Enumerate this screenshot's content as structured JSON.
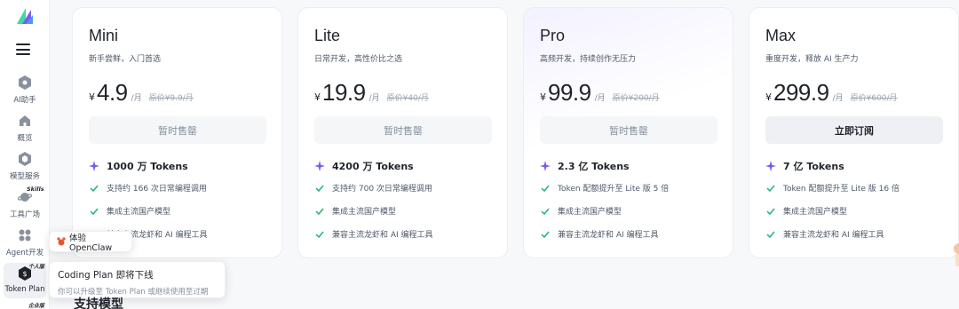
{
  "sidebar": {
    "items": [
      {
        "label": "AI助手",
        "icon": "hexagon-icon"
      },
      {
        "label": "概览",
        "icon": "home-icon"
      },
      {
        "label": "模型服务",
        "icon": "hexagon-icon"
      },
      {
        "label": "工具广场",
        "icon": "planet-icon",
        "tag": "Skills"
      },
      {
        "label": "Agent开发",
        "icon": "grid-icon"
      },
      {
        "label": "Token Plan",
        "icon": "token-icon",
        "tag": "个人版"
      }
    ],
    "bottom_tag": "企业版"
  },
  "plans": [
    {
      "name": "Mini",
      "subtitle": "新手尝鲜，入门首选",
      "currency": "¥",
      "price": "4.9",
      "unit": "/月",
      "original": "原价¥9.9/月",
      "cta": "暂时售罄",
      "cta_enabled": false,
      "tokens": "1000 万 Tokens",
      "features": [
        "支持约 166 次日常编程调用",
        "集成主流国产模型",
        "兼容主流龙虾和 AI 编程工具"
      ]
    },
    {
      "name": "Lite",
      "subtitle": "日常开发，高性价比之选",
      "currency": "¥",
      "price": "19.9",
      "unit": "/月",
      "original": "原价¥40/月",
      "cta": "暂时售罄",
      "cta_enabled": false,
      "tokens": "4200 万 Tokens",
      "features": [
        "支持约 700 次日常编程调用",
        "集成主流国产模型",
        "兼容主流龙虾和 AI 编程工具"
      ]
    },
    {
      "name": "Pro",
      "subtitle": "高频开发，持续创作无压力",
      "currency": "¥",
      "price": "99.9",
      "unit": "/月",
      "original": "原价¥200/月",
      "cta": "暂时售罄",
      "cta_enabled": false,
      "tokens": "2.3 亿 Tokens",
      "features": [
        "Token 配额提升至 Lite 版 5 倍",
        "集成主流国产模型",
        "兼容主流龙虾和 AI 编程工具"
      ]
    },
    {
      "name": "Max",
      "subtitle": "重度开发，释放 AI 生产力",
      "currency": "¥",
      "price": "299.9",
      "unit": "/月",
      "original": "原价¥600/月",
      "cta": "立即订阅",
      "cta_enabled": true,
      "tokens": "7 亿 Tokens",
      "features": [
        "Token 配额提升至 Lite 版 16 倍",
        "集成主流国产模型",
        "兼容主流龙虾和 AI 编程工具"
      ]
    }
  ],
  "popups": {
    "openclaw": "体验 OpenClaw",
    "notice_title": "Coding Plan 即将下线",
    "notice_body": "你可以升级至 Token Plan 或继续使用至过期"
  },
  "section_title": "支持模型",
  "colors": {
    "accent": "#6e5cf6",
    "check": "#1fb37f",
    "text": "#1f2329",
    "muted": "#86909c"
  }
}
